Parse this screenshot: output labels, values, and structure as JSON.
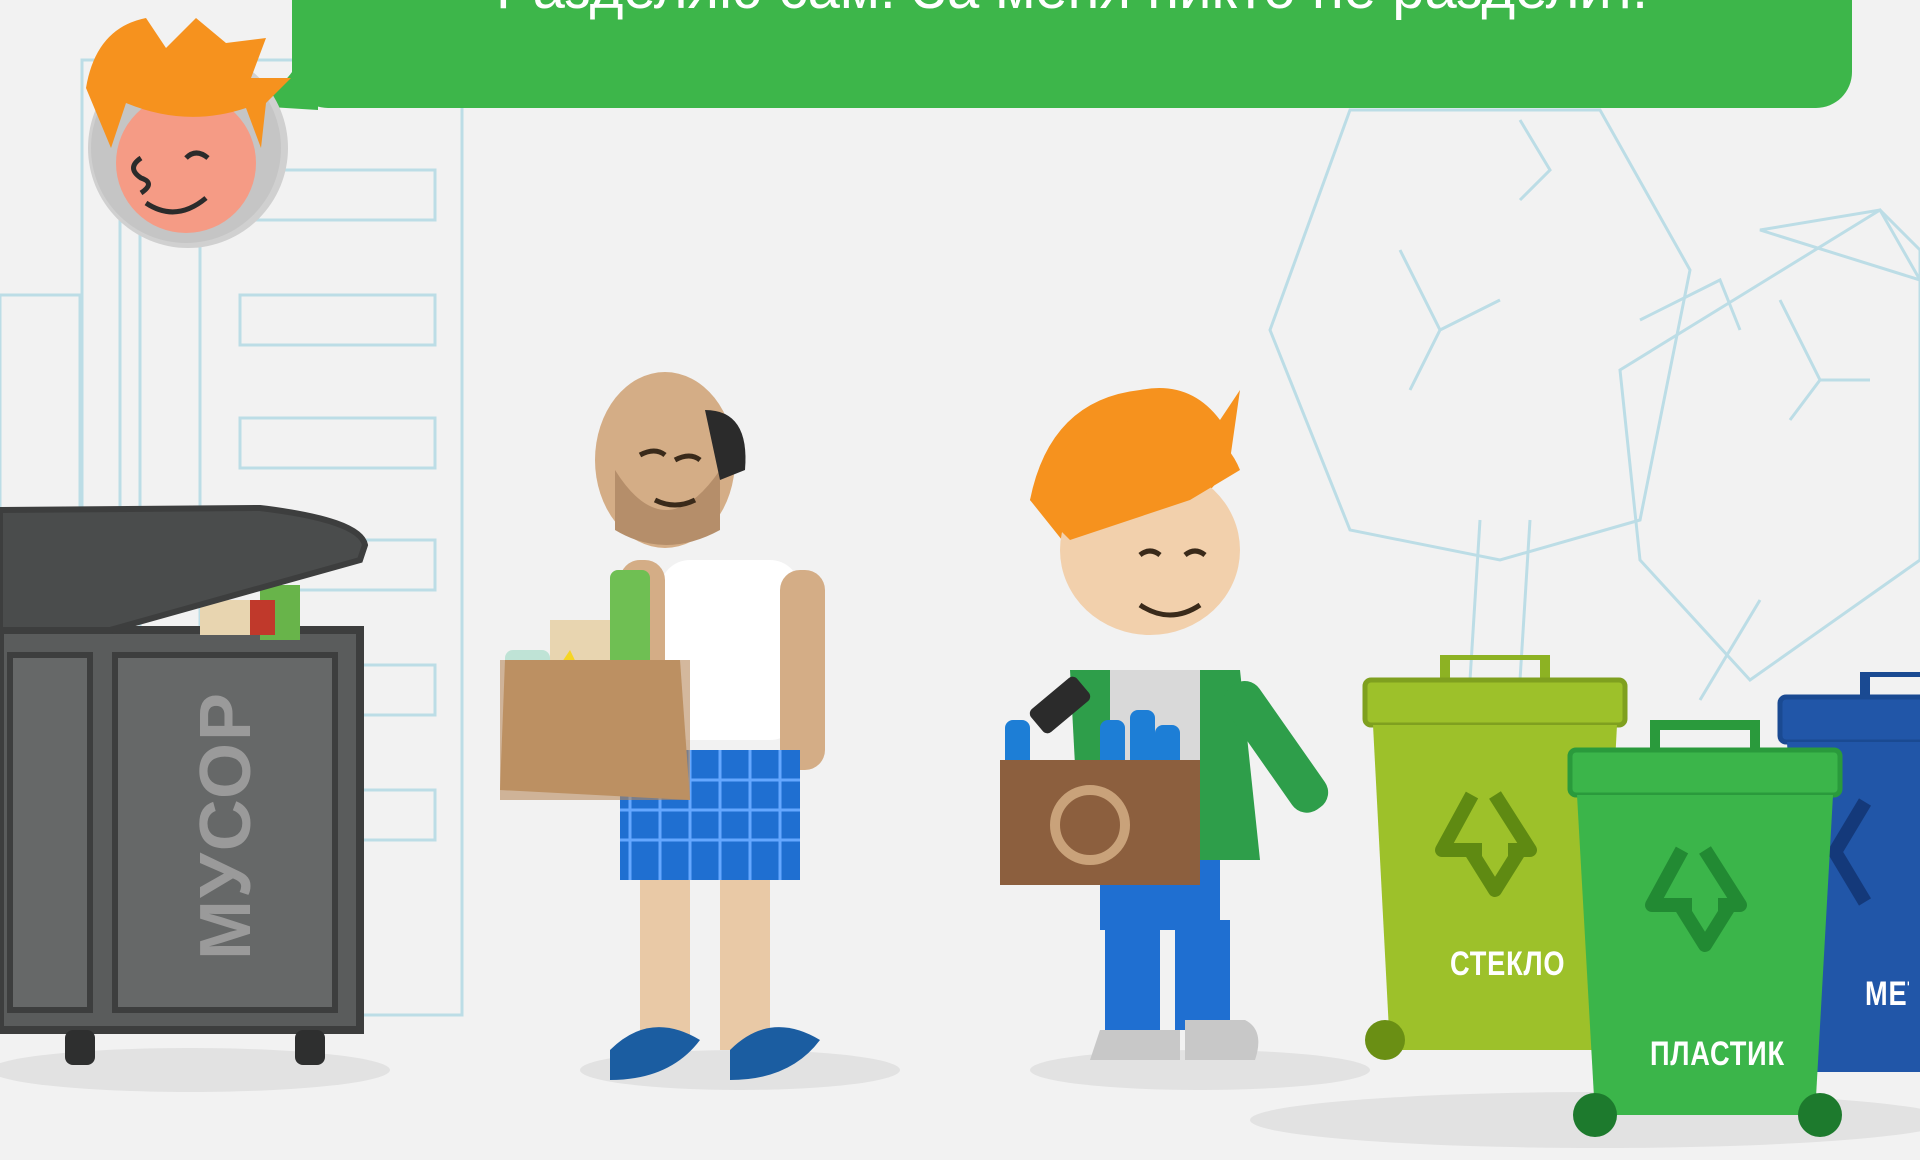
{
  "dialog": {
    "text": "Разделяю сам. За меня никто не разделит."
  },
  "bins": {
    "general": {
      "label": "МУСОР",
      "color": "#5a5c5c"
    },
    "glass": {
      "label": "СТЕКЛО",
      "color": "#9dc12a"
    },
    "plastic": {
      "label": "ПЛАСТИК",
      "color": "#3bb54a"
    },
    "metal": {
      "label": "МЕТАЛЛ",
      "color": "#2156a8"
    }
  },
  "colors": {
    "accent": "#3db64a",
    "background": "#f2f2f2",
    "hair": "#f6921e"
  },
  "characters": {
    "avatar": "orange-haired-boy-avatar",
    "neighbor": "bald-man-with-mixed-trash",
    "hero": "orange-haired-boy-with-plastic-bottles"
  }
}
